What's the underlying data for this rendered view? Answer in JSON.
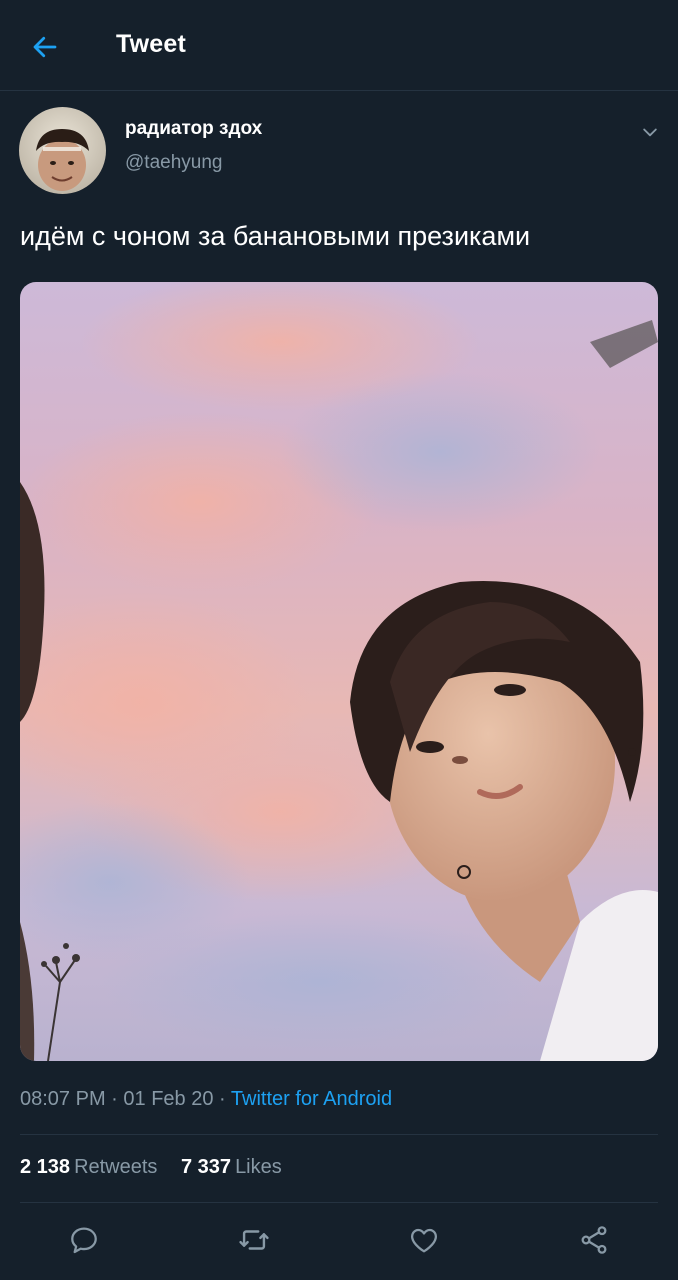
{
  "header": {
    "title": "Tweet",
    "back_icon": "arrow-left-icon",
    "accent_color": "#1da1f2"
  },
  "author": {
    "display_name": "радиатор здох",
    "handle": "@taehyung",
    "avatar_icon": "avatar-photo",
    "menu_icon": "chevron-down-icon"
  },
  "tweet": {
    "text": "идём с чоном за банановыми презиками",
    "media_icon": "photo-selfie-pink-sky"
  },
  "meta": {
    "time": "08:07 PM",
    "sep1": "·",
    "date": "01 Feb 20",
    "sep2": "·",
    "source": "Twitter for Android"
  },
  "stats": {
    "retweets_count": "2 138",
    "retweets_label": "Retweets",
    "likes_count": "7 337",
    "likes_label": "Likes"
  },
  "actions": [
    {
      "icon": "reply-icon"
    },
    {
      "icon": "retweet-icon"
    },
    {
      "icon": "like-heart-icon"
    },
    {
      "icon": "share-icon"
    }
  ],
  "colors": {
    "background": "#15202b",
    "divider": "#253341",
    "secondary_text": "#8899a6",
    "link": "#1da1f2"
  }
}
